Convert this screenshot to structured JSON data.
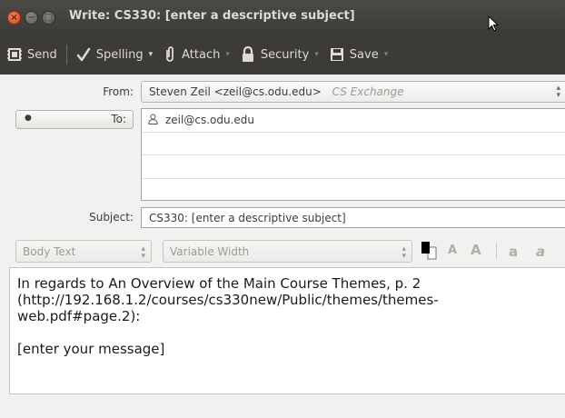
{
  "window": {
    "title": "Write: CS330: [enter a descriptive subject]",
    "close_glyph": "×",
    "min_glyph": "−",
    "max_glyph": "□"
  },
  "toolbar": {
    "send_label": "Send",
    "spelling_label": "Spelling",
    "attach_label": "Attach",
    "security_label": "Security",
    "save_label": "Save",
    "dropdown_glyph": "▾",
    "icons": [
      "send-icon",
      "spelling-check-icon",
      "paperclip-icon",
      "lock-icon",
      "floppy-disk-icon"
    ]
  },
  "header": {
    "from_label": "From:",
    "from_value": "Steven Zeil <zeil@cs.odu.edu>",
    "from_account": "CS Exchange",
    "to_label": "To:",
    "recipients": [
      "zeil@cs.odu.edu",
      "",
      "",
      ""
    ],
    "subject_label": "Subject:",
    "subject_value": "CS330: [enter a descriptive subject]"
  },
  "format_bar": {
    "paragraph_style": "Body Text",
    "font": "Variable Width",
    "text_color": "#000000",
    "background_color": "#ffffff",
    "smaller_glyph": "A",
    "larger_glyph": "A",
    "bold_glyph": "a",
    "italic_glyph": "a"
  },
  "body": {
    "lines": [
      "In regards to An Overview of the Main Course Themes, p. 2",
      "(http://192.168.1.2/courses/cs330new/Public/themes/themes-",
      "web.pdf#page.2):",
      "",
      "[enter your message]"
    ]
  },
  "colors": {
    "titlebar": "#3c3b37",
    "close_button": "#e05a2b",
    "toolbar_text": "#dfdbd2",
    "window_bg": "#f2f1f0"
  }
}
